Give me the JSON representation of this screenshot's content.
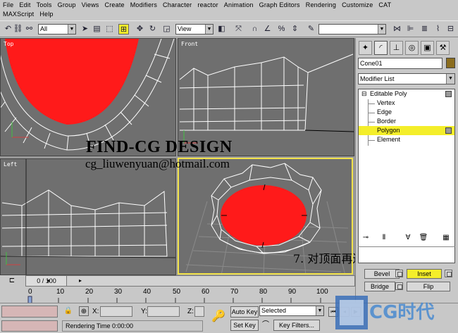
{
  "menu": [
    "File",
    "Edit",
    "Tools",
    "Group",
    "Views",
    "Create",
    "Modifiers",
    "Character",
    "reactor",
    "Animation",
    "Graph Editors",
    "Rendering",
    "Customize",
    "CAT",
    "MAXScript",
    "Help"
  ],
  "toolbar": {
    "selection_filter": "All",
    "reference_coord": "View",
    "named_selection": ""
  },
  "viewports": {
    "top": "Top",
    "front": "Front",
    "left": "Left",
    "perspective": ""
  },
  "watermark": {
    "title": "FIND-CG DESIGN",
    "email": "cg_liuwenyuan@hotmail.com",
    "step": "7. 对顶面再进行一次插入"
  },
  "command_panel": {
    "object_name": "Cone01",
    "modifier_list": "Modifier List",
    "stack": {
      "root": "Editable Poly",
      "items": [
        "Vertex",
        "Edge",
        "Border",
        "Polygon",
        "Element"
      ],
      "selected": "Polygon"
    },
    "buttons": {
      "bevel": "Bevel",
      "inset": "Inset",
      "bridge": "Bridge",
      "flip": "Flip"
    }
  },
  "time": {
    "slider": "0 / 100",
    "ticks": [
      "0",
      "10",
      "20",
      "30",
      "40",
      "50",
      "60",
      "70",
      "80",
      "90",
      "100"
    ]
  },
  "status": {
    "x_label": "X:",
    "y_label": "Y:",
    "z_label": "Z:",
    "auto_key": "Auto Key",
    "set_key": "Set Key",
    "key_mode": "Selected",
    "key_filters": "Key Filters...",
    "rendering_time": "Rendering Time  0:00:00"
  },
  "logo_text": "CG时代",
  "colors": {
    "active_border": "#f2e34a",
    "highlight": "#f4ee2a",
    "object_red": "#ff1a1a",
    "viewport_bg": "#6f6f6f"
  }
}
